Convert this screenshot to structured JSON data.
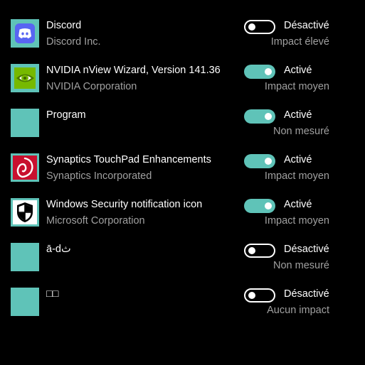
{
  "colors": {
    "background": "#000000",
    "accent": "#5fc3b8",
    "text_primary": "#ffffff",
    "text_secondary": "#a0a0a0"
  },
  "apps": [
    {
      "name": "Discord",
      "publisher": "Discord Inc.",
      "enabled": false,
      "status": "Désactivé",
      "impact": "Impact élevé",
      "icon": "discord-icon"
    },
    {
      "name": "NVIDIA nView Wizard, Version 141.36",
      "publisher": "NVIDIA Corporation",
      "enabled": true,
      "status": "Activé",
      "impact": "Impact moyen",
      "icon": "nvidia-icon"
    },
    {
      "name": "Program",
      "publisher": "",
      "enabled": true,
      "status": "Activé",
      "impact": "Non mesuré",
      "icon": "generic-app-icon"
    },
    {
      "name": "Synaptics TouchPad Enhancements",
      "publisher": "Synaptics Incorporated",
      "enabled": true,
      "status": "Activé",
      "impact": "Impact moyen",
      "icon": "synaptics-icon"
    },
    {
      "name": "Windows Security notification icon",
      "publisher": "Microsoft Corporation",
      "enabled": true,
      "status": "Activé",
      "impact": "Impact moyen",
      "icon": "windows-security-shield-icon"
    },
    {
      "name": "ā-dث",
      "publisher": "",
      "enabled": false,
      "status": "Désactivé",
      "impact": "Non mesuré",
      "icon": "generic-app-icon"
    },
    {
      "name": "□□",
      "publisher": "",
      "enabled": false,
      "status": "Désactivé",
      "impact": "Aucun impact",
      "icon": "generic-app-icon"
    }
  ]
}
